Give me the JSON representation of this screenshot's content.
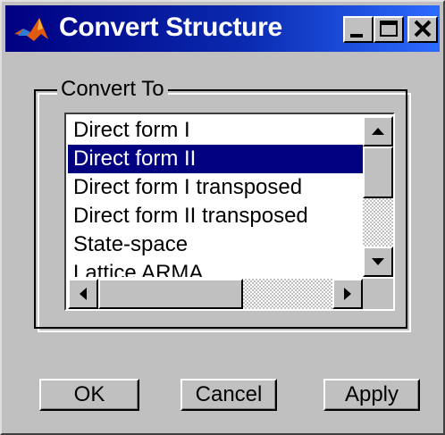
{
  "window": {
    "title": "Convert Structure",
    "controls": [
      "minimize-icon",
      "maximize-icon",
      "close-icon"
    ]
  },
  "group": {
    "label": "Convert To"
  },
  "list": {
    "items": [
      "Direct form I",
      "Direct form II",
      "Direct form I transposed",
      "Direct form II transposed",
      "State-space",
      "Lattice ARMA"
    ],
    "selected_index": 1
  },
  "buttons": {
    "ok": "OK",
    "cancel": "Cancel",
    "apply": "Apply"
  },
  "colors": {
    "title_bar": "#000080",
    "selection": "#000080",
    "face": "#c0c0c0"
  }
}
